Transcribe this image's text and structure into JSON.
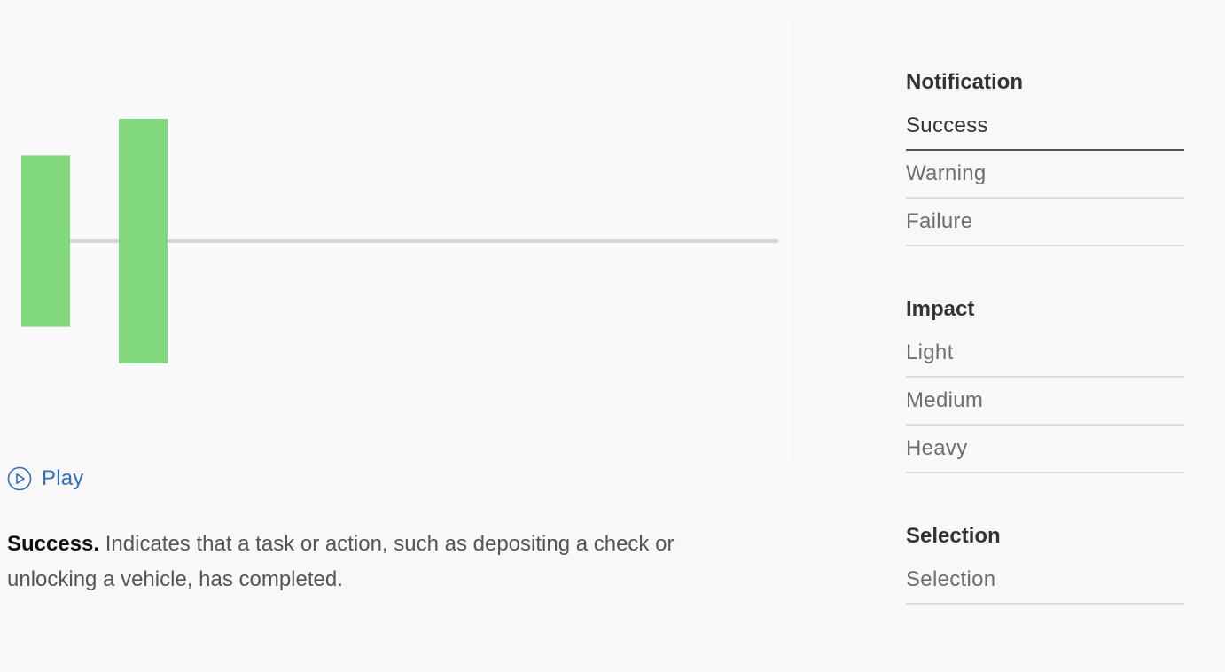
{
  "visualization": {
    "bar_color": "#82d87c",
    "baseline_color": "#d6d6d6",
    "pulses": [
      {
        "intensity": 0.7
      },
      {
        "intensity": 1.0
      }
    ]
  },
  "play": {
    "label": "Play",
    "icon": "play-circle-icon",
    "color": "#2f6fbd"
  },
  "description": {
    "term": "Success.",
    "text": " Indicates that a task or action, such as depositing a check or unlocking a vehicle, has completed."
  },
  "sidebar": {
    "sections": [
      {
        "title": "Notification",
        "options": [
          "Success",
          "Warning",
          "Failure"
        ],
        "selected": "Success"
      },
      {
        "title": "Impact",
        "options": [
          "Light",
          "Medium",
          "Heavy"
        ],
        "selected": null
      },
      {
        "title": "Selection",
        "options": [
          "Selection"
        ],
        "selected": null
      }
    ]
  }
}
